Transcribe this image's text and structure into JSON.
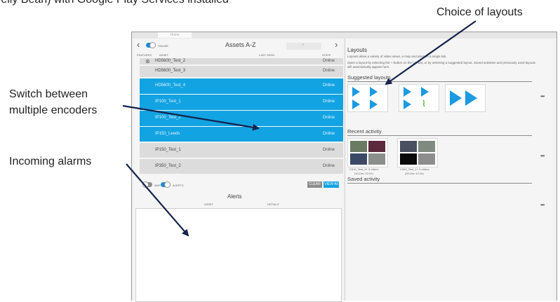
{
  "captions": {
    "top_left": "(Jelly Bean) with Google Play Services installed",
    "top_right": "Choice of layouts",
    "switch_line1": "Switch between",
    "switch_line2": "multiple encoders",
    "incoming": "Incoming alarms"
  },
  "tab": {
    "label": "Home"
  },
  "assets_panel": {
    "title": "Assets A-Z",
    "online_label": "ONLINE",
    "columns": {
      "features": "FEATURES",
      "asset": "ASSET",
      "last_seen": "LAST SEEN",
      "state": "STATE"
    },
    "rows": [
      {
        "name": "HD5600_Test_2",
        "state": "Online",
        "selected": false
      },
      {
        "name": "HD5600_Test_3",
        "state": "Online",
        "selected": false
      },
      {
        "name": "HD5600_Test_4",
        "state": "Online",
        "selected": true
      },
      {
        "name": "IP100_Test_1",
        "state": "Online",
        "selected": true
      },
      {
        "name": "IP100_Test_2",
        "state": "Online",
        "selected": true
      },
      {
        "name": "IP150_Leeds",
        "state": "Online",
        "selected": true
      },
      {
        "name": "IP150_Test_1",
        "state": "Online",
        "selected": false
      },
      {
        "name": "IP350_Test_2",
        "state": "Online",
        "selected": false
      }
    ]
  },
  "alerts_panel": {
    "map_label": "MAP",
    "alerts_label": "ALERTS",
    "clear_button": "CLEAR",
    "view_all_button": "VIEW All",
    "title": "Alerts",
    "columns": {
      "asset": "ASSET",
      "details": "DETAILS"
    }
  },
  "layouts_panel": {
    "title": "Layouts",
    "description": "Layouts allow a variety of video views, a map and alerts in a single tab.",
    "description2": "Open a layout by selecting the + button on the tab bar, or by selecting a suggested layout. Saved activities and previously used layouts will automatically appear here.",
    "suggested_heading": "Suggested layouts",
    "recent_heading": "Recent activity",
    "saved_heading": "Saved activity",
    "recent_items": [
      {
        "caption1": "C310_Test_3+ 3 others",
        "caption2": "(10-Dec 22:31)"
      },
      {
        "caption1": "C300_Test_1+ 3 others",
        "caption2": "(09-Dec 12:19)"
      }
    ],
    "more_icon_text": "•••"
  },
  "colors": {
    "accent": "#12a3e3",
    "toggle": "#1f8ad2",
    "arrow": "#14234b"
  }
}
